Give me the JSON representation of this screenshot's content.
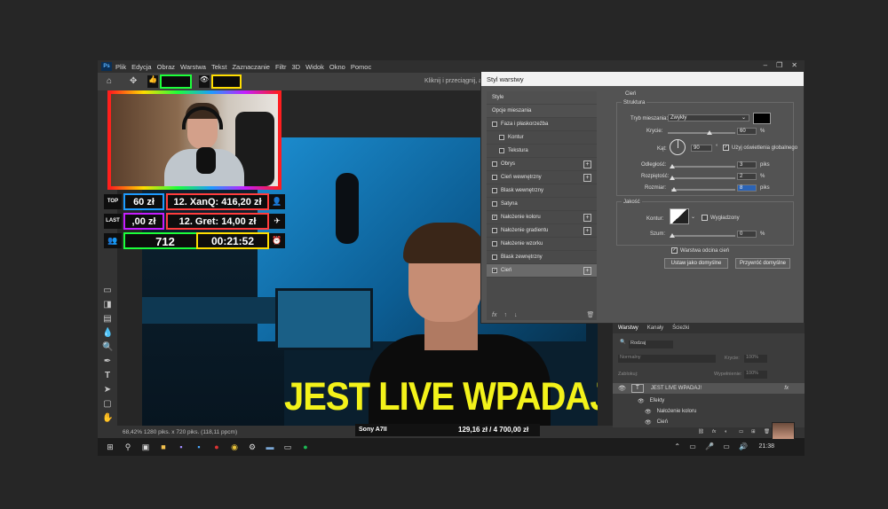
{
  "photoshop": {
    "menu": [
      "Plik",
      "Edycja",
      "Obraz",
      "Warstwa",
      "Tekst",
      "Zaznaczanie",
      "Filtr",
      "3D",
      "Widok",
      "Okno",
      "Pomoc"
    ],
    "logo": "Ps",
    "options_hint": "Kliknij i przeciągnij, aby ...",
    "headline": "JEST LIVE WPADAJ!",
    "status": "68,42%    1280 piks. x 720 piks. (118,11 ppcm)"
  },
  "overlay": {
    "top_tag": "TOP",
    "top_amount": "60 zł",
    "top_donor": "12. XanQ: 416,20 zł",
    "last_tag": "LAST",
    "last_amount": ",00 zł",
    "last_donor": "12. Gret: 14,00 zł",
    "viewers": "712",
    "timer": "00:21:52",
    "camera_label": "Sony A7II",
    "goal": "129,16 zł / 4 700,00 zł"
  },
  "dialog": {
    "title": "Styl warstwy",
    "styles": [
      {
        "label": "Style",
        "checkbox": false,
        "plus": false,
        "checked": false,
        "indent": false,
        "head": true
      },
      {
        "label": "Opcje mieszania",
        "checkbox": false,
        "plus": false,
        "checked": false,
        "indent": false,
        "head": true
      },
      {
        "label": "Faza i płaskorzeźba",
        "checkbox": true,
        "plus": false,
        "checked": false,
        "indent": false,
        "head": false
      },
      {
        "label": "Kontur",
        "checkbox": true,
        "plus": false,
        "checked": false,
        "indent": true,
        "head": false
      },
      {
        "label": "Tekstura",
        "checkbox": true,
        "plus": false,
        "checked": false,
        "indent": true,
        "head": false
      },
      {
        "label": "Obrys",
        "checkbox": true,
        "plus": true,
        "checked": false,
        "indent": false,
        "head": false
      },
      {
        "label": "Cień wewnętrzny",
        "checkbox": true,
        "plus": true,
        "checked": false,
        "indent": false,
        "head": false
      },
      {
        "label": "Blask wewnętrzny",
        "checkbox": true,
        "plus": false,
        "checked": false,
        "indent": false,
        "head": false
      },
      {
        "label": "Satyna",
        "checkbox": true,
        "plus": false,
        "checked": false,
        "indent": false,
        "head": false
      },
      {
        "label": "Nałożenie koloru",
        "checkbox": true,
        "plus": true,
        "checked": true,
        "indent": false,
        "head": false
      },
      {
        "label": "Nałożenie gradientu",
        "checkbox": true,
        "plus": true,
        "checked": false,
        "indent": false,
        "head": false
      },
      {
        "label": "Nałożenie wzorku",
        "checkbox": true,
        "plus": false,
        "checked": false,
        "indent": false,
        "head": false
      },
      {
        "label": "Blask zewnętrzny",
        "checkbox": true,
        "plus": false,
        "checked": false,
        "indent": false,
        "head": false
      },
      {
        "label": "Cień",
        "checkbox": true,
        "plus": true,
        "checked": true,
        "indent": false,
        "head": false,
        "selected": true
      }
    ],
    "footer": "fx",
    "section_title": "Cień",
    "structure": "Struktura",
    "blend_mode_label": "Tryb mieszania:",
    "blend_mode": "Zwykły",
    "opacity_label": "Krycie:",
    "opacity": "60",
    "angle_label": "Kąt:",
    "angle": "90",
    "global_light": "Użyj oświetlenia globalnego",
    "distance_label": "Odległość:",
    "distance": "3",
    "spread_label": "Rozpiętość:",
    "spread": "2",
    "size_label": "Rozmiar:",
    "size": "8",
    "unit_px": "piks",
    "unit_pct": "%",
    "quality": "Jakość",
    "contour_label": "Kontur:",
    "antialias": "Wygładzony",
    "noise_label": "Szum:",
    "noise": "0",
    "knockout": "Warstwa odcina cień",
    "btn_default": "Ustaw jako domyślne",
    "btn_reset": "Przywróć domyślne"
  },
  "layers": {
    "tabs": [
      "Warstwy",
      "Kanały",
      "Ścieżki"
    ],
    "search": "Rodzaj",
    "blend": "Normalny",
    "opacity_label": "Krycie:",
    "opacity": "100%",
    "lock_label": "Zablokuj:",
    "fill_label": "Wypełnienie:",
    "fill": "100%",
    "layer_name": "JEST LIVE WPADAJ!",
    "effects": "Efekty",
    "effect1": "Nałożenie koloru",
    "effect2": "Cień"
  },
  "taskbar": {
    "clock": "21:38"
  }
}
